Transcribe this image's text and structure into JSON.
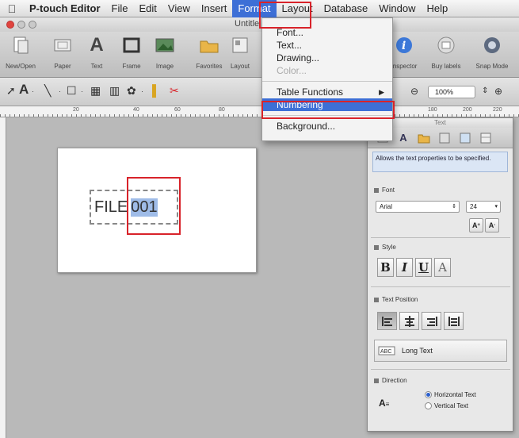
{
  "menubar": {
    "apple": "",
    "app": "P-touch Editor",
    "items": [
      "File",
      "Edit",
      "View",
      "Insert",
      "Format",
      "Layout",
      "Database",
      "Window",
      "Help"
    ]
  },
  "window": {
    "title": "Untitle"
  },
  "toolbar": {
    "buttons": [
      "New/Open",
      "Paper",
      "Text",
      "Frame",
      "Image",
      "Favorites",
      "Layout",
      "Inspector",
      "Buy labels",
      "Snap Mode"
    ]
  },
  "toolbar2": {
    "zoom": "100%"
  },
  "ruler": {
    "ticks": [
      "20",
      "40",
      "60",
      "80",
      "180",
      "200",
      "220"
    ]
  },
  "format_menu": {
    "items": [
      {
        "label": "Font...",
        "disabled": false
      },
      {
        "label": "Text...",
        "disabled": false
      },
      {
        "label": "Drawing...",
        "disabled": false
      },
      {
        "label": "Color...",
        "disabled": true
      }
    ],
    "table_functions": "Table Functions",
    "numbering": "Numbering",
    "background": "Background..."
  },
  "label_object": {
    "prefix": "FILE",
    "number": "001"
  },
  "inspector": {
    "title": "Text",
    "description": "Allows the text properties to be specified.",
    "font_section": "Font",
    "font_name": "Arial",
    "font_size": "24",
    "style_section": "Style",
    "style_buttons": [
      "B",
      "I",
      "U",
      "A"
    ],
    "position_section": "Text Position",
    "long_text": "Long Text",
    "direction_section": "Direction",
    "direction_options": [
      "Horizontal Text",
      "Vertical Text"
    ]
  },
  "colors": {
    "highlight": "#d8232a",
    "menu_selected": "#3d6fd6"
  }
}
